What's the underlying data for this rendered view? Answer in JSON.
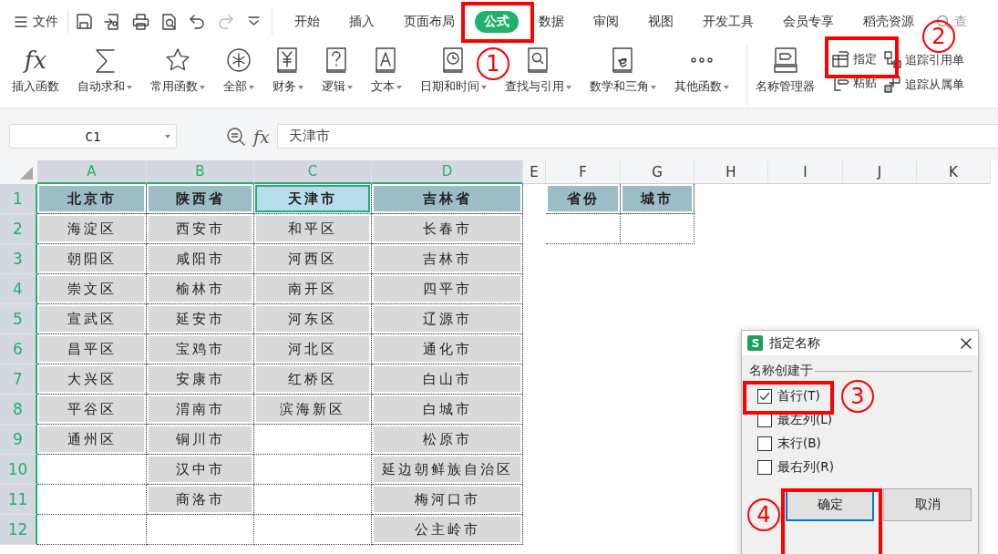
{
  "toolbar": {
    "menu_label": "文件",
    "quick_access": [
      {
        "disabled": false
      },
      {
        "disabled": false
      },
      {
        "disabled": false
      },
      {
        "disabled": false
      },
      {
        "disabled": false
      },
      {
        "disabled": true
      },
      {
        "disabled": false
      }
    ]
  },
  "tabs": [
    {
      "label": "开始",
      "selected": false
    },
    {
      "label": "插入",
      "selected": false
    },
    {
      "label": "页面布局",
      "selected": false
    },
    {
      "label": "公式",
      "selected": true
    },
    {
      "label": "数据",
      "selected": false
    },
    {
      "label": "审阅",
      "selected": false
    },
    {
      "label": "视图",
      "selected": false
    },
    {
      "label": "开发工具",
      "selected": false
    },
    {
      "label": "会员专享",
      "selected": false
    },
    {
      "label": "稻壳资源",
      "selected": false
    }
  ],
  "search": {
    "placeholder": "查"
  },
  "ribbon": {
    "function_buttons": [
      {
        "label": "插入函数",
        "symbol": "fx",
        "dropdown": false
      },
      {
        "label": "自动求和",
        "dropdown": true
      },
      {
        "label": "常用函数",
        "dropdown": true
      },
      {
        "label": "全部",
        "dropdown": true
      },
      {
        "label": "财务",
        "dropdown": true
      },
      {
        "label": "逻辑",
        "dropdown": true
      },
      {
        "label": "文本",
        "dropdown": true
      },
      {
        "label": "日期和时间",
        "dropdown": true
      },
      {
        "label": "查找与引用",
        "dropdown": true
      },
      {
        "label": "数学和三角",
        "dropdown": true
      },
      {
        "label": "其他函数",
        "dropdown": true
      }
    ],
    "name_manager": "名称管理器",
    "name_buttons": [
      {
        "label": "指定"
      },
      {
        "label": "粘贴"
      }
    ],
    "trace_buttons": [
      {
        "label": "追踪引用单"
      },
      {
        "label": "追踪从属单"
      }
    ]
  },
  "name_box": {
    "value": "C1"
  },
  "formula_bar": {
    "fx_label": "fx",
    "value": "天津市"
  },
  "sheet": {
    "columns": [
      {
        "label": "A",
        "selected": true
      },
      {
        "label": "B",
        "selected": true
      },
      {
        "label": "C",
        "selected": true
      },
      {
        "label": "D",
        "selected": true
      },
      {
        "label": "E",
        "selected": false
      },
      {
        "label": "F",
        "selected": false
      },
      {
        "label": "G",
        "selected": false
      },
      {
        "label": "H",
        "selected": false
      },
      {
        "label": "I",
        "selected": false
      },
      {
        "label": "J",
        "selected": false
      },
      {
        "label": "K",
        "selected": false
      }
    ],
    "rows": [
      {
        "number": "1",
        "selected": true,
        "cells": [
          {
            "kind": "header",
            "text": "北京市",
            "selected": false
          },
          {
            "kind": "header",
            "text": "陕西省",
            "selected": false
          },
          {
            "kind": "header",
            "text": "天津市",
            "selected": true
          },
          {
            "kind": "header",
            "text": "吉林省",
            "selected": false
          }
        ]
      },
      {
        "number": "2",
        "selected": true,
        "cells": [
          {
            "kind": "data",
            "text": "海淀区",
            "selected": false
          },
          {
            "kind": "data",
            "text": "西安市",
            "selected": false
          },
          {
            "kind": "data",
            "text": "和平区",
            "selected": false
          },
          {
            "kind": "data",
            "text": "长春市",
            "selected": false
          }
        ]
      },
      {
        "number": "3",
        "selected": true,
        "cells": [
          {
            "kind": "data",
            "text": "朝阳区",
            "selected": false
          },
          {
            "kind": "data",
            "text": "咸阳市",
            "selected": false
          },
          {
            "kind": "data",
            "text": "河西区",
            "selected": false
          },
          {
            "kind": "data",
            "text": "吉林市",
            "selected": false
          }
        ]
      },
      {
        "number": "4",
        "selected": true,
        "cells": [
          {
            "kind": "data",
            "text": "崇文区",
            "selected": false
          },
          {
            "kind": "data",
            "text": "榆林市",
            "selected": false
          },
          {
            "kind": "data",
            "text": "南开区",
            "selected": false
          },
          {
            "kind": "data",
            "text": "四平市",
            "selected": false
          }
        ]
      },
      {
        "number": "5",
        "selected": true,
        "cells": [
          {
            "kind": "data",
            "text": "宣武区",
            "selected": false
          },
          {
            "kind": "data",
            "text": "延安市",
            "selected": false
          },
          {
            "kind": "data",
            "text": "河东区",
            "selected": false
          },
          {
            "kind": "data",
            "text": "辽源市",
            "selected": false
          }
        ]
      },
      {
        "number": "6",
        "selected": true,
        "cells": [
          {
            "kind": "data",
            "text": "昌平区",
            "selected": false
          },
          {
            "kind": "data",
            "text": "宝鸡市",
            "selected": false
          },
          {
            "kind": "data",
            "text": "河北区",
            "selected": false
          },
          {
            "kind": "data",
            "text": "通化市",
            "selected": false
          }
        ]
      },
      {
        "number": "7",
        "selected": true,
        "cells": [
          {
            "kind": "data",
            "text": "大兴区",
            "selected": false
          },
          {
            "kind": "data",
            "text": "安康市",
            "selected": false
          },
          {
            "kind": "data",
            "text": "红桥区",
            "selected": false
          },
          {
            "kind": "data",
            "text": "白山市",
            "selected": false
          }
        ]
      },
      {
        "number": "8",
        "selected": true,
        "cells": [
          {
            "kind": "data",
            "text": "平谷区",
            "selected": false
          },
          {
            "kind": "data",
            "text": "渭南市",
            "selected": false
          },
          {
            "kind": "data",
            "text": "滨海新区",
            "selected": false
          },
          {
            "kind": "data",
            "text": "白城市",
            "selected": false
          }
        ]
      },
      {
        "number": "9",
        "selected": true,
        "cells": [
          {
            "kind": "data",
            "text": "通州区",
            "selected": false
          },
          {
            "kind": "data",
            "text": "铜川市",
            "selected": false
          },
          {
            "kind": "empty",
            "selected": false
          },
          {
            "kind": "data",
            "text": "松原市",
            "selected": false
          }
        ]
      },
      {
        "number": "10",
        "selected": true,
        "cells": [
          {
            "kind": "empty",
            "selected": false
          },
          {
            "kind": "data",
            "text": "汉中市",
            "selected": false
          },
          {
            "kind": "empty",
            "selected": false
          },
          {
            "kind": "data",
            "text": "延边朝鲜族自治区",
            "selected": false
          }
        ]
      },
      {
        "number": "11",
        "selected": true,
        "cells": [
          {
            "kind": "empty",
            "selected": false
          },
          {
            "kind": "data",
            "text": "商洛市",
            "selected": false
          },
          {
            "kind": "empty",
            "selected": false
          },
          {
            "kind": "data",
            "text": "梅河口市",
            "selected": false
          }
        ]
      },
      {
        "number": "12",
        "selected": true,
        "cells": [
          {
            "kind": "empty",
            "selected": false
          },
          {
            "kind": "empty",
            "selected": false
          },
          {
            "kind": "empty",
            "selected": false
          },
          {
            "kind": "data",
            "text": "公主岭市",
            "selected": false
          }
        ]
      }
    ],
    "side_table": {
      "rows": [
        [
          {
            "kind": "header",
            "text": "省份",
            "selected": false
          },
          {
            "kind": "header",
            "text": "城市",
            "selected": false
          }
        ],
        [
          {
            "kind": "empty",
            "selected": false
          },
          {
            "kind": "empty",
            "selected": false
          }
        ]
      ]
    }
  },
  "dialog": {
    "title": "指定名称",
    "group_label": "名称创建于",
    "options": [
      {
        "label": "首行(T)",
        "checked": true
      },
      {
        "label": "最左列(L)",
        "checked": false
      },
      {
        "label": "末行(B)",
        "checked": false
      },
      {
        "label": "最右列(R)",
        "checked": false
      }
    ],
    "buttons": [
      {
        "label": "确定",
        "focused": true
      },
      {
        "label": "取消",
        "focused": false
      }
    ]
  },
  "annotations": [
    {
      "number": "1",
      "kind": "step"
    },
    {
      "number": "2",
      "kind": "step"
    },
    {
      "number": "3",
      "kind": "step"
    },
    {
      "number": "4",
      "kind": "step"
    }
  ]
}
